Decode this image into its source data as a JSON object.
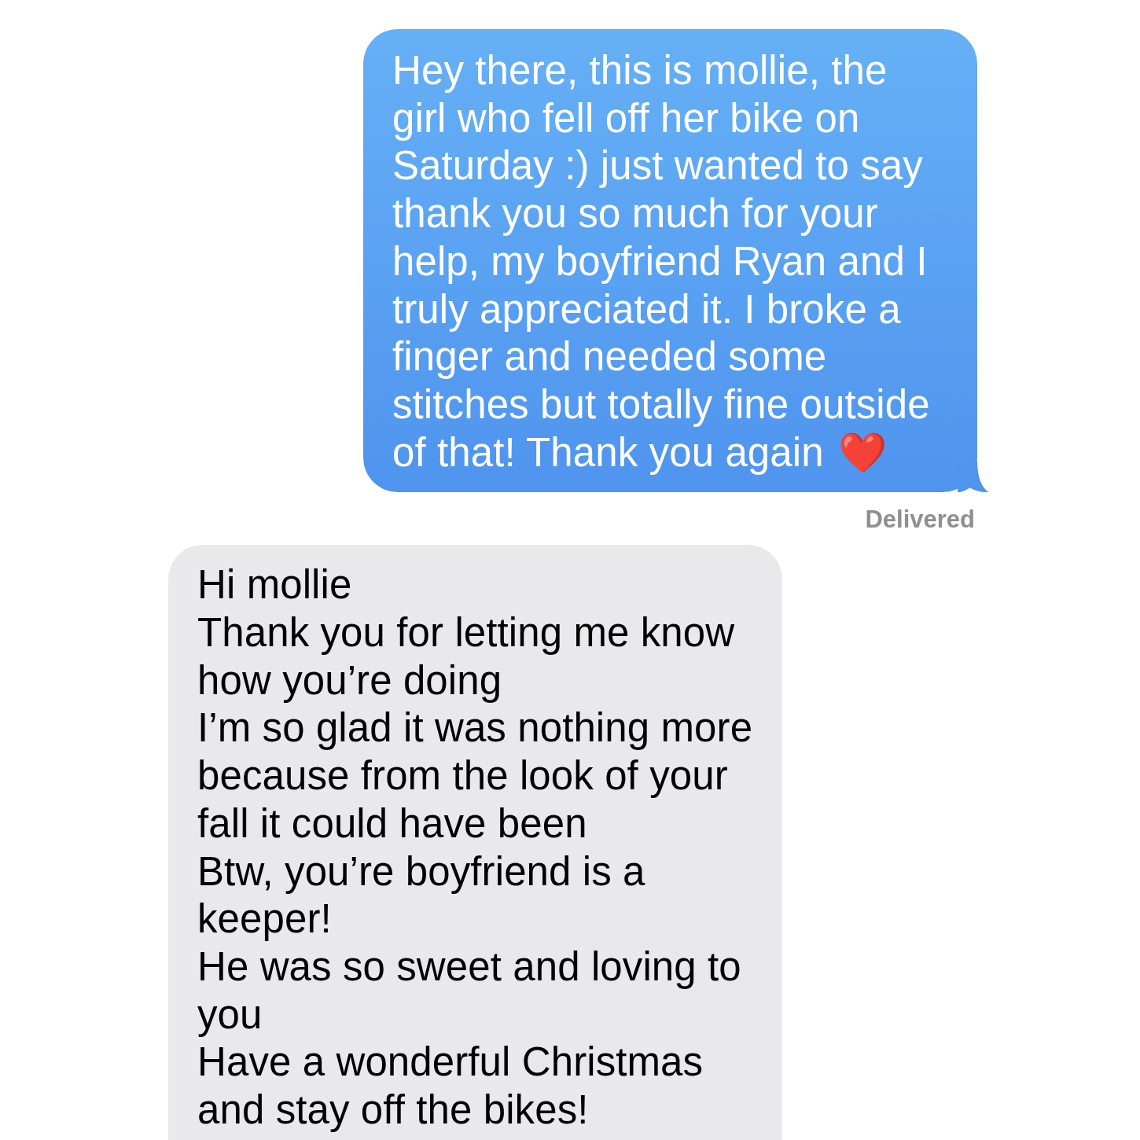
{
  "messages": [
    {
      "kind": "sent",
      "text": "Hey there, this is mollie, the girl who fell off her bike on Saturday :) just wanted to say thank you so much for your help, my boyfriend Ryan and I truly appreciated it. I broke a finger and needed some stitches but totally fine outside of that! Thank you again",
      "emoji": "❤️",
      "status": "Delivered"
    },
    {
      "kind": "received",
      "text": "Hi mollie\nThank you for letting me know how you’re doing\nI’m so glad it was nothing more because from the look of your fall it could have been\nBtw, you’re boyfriend is a keeper!\nHe was so sweet and loving to you\nHave a wonderful Christmas and stay off the bikes!"
    }
  ]
}
